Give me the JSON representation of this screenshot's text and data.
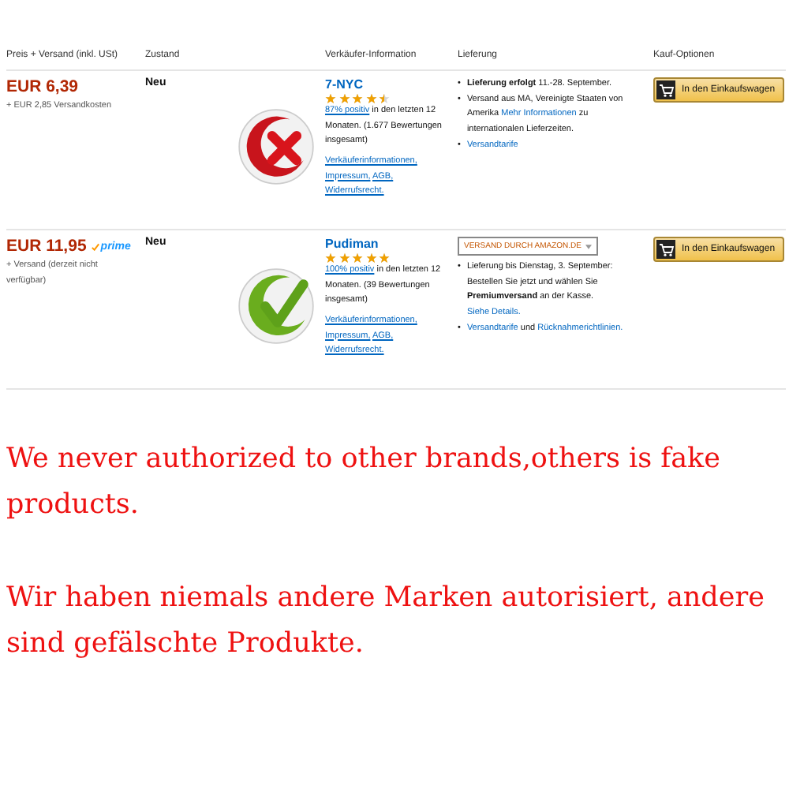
{
  "columns": [
    "Preis + Versand (inkl. USt)",
    "Zustand",
    "",
    "Verkäufer-Information",
    "Lieferung",
    "Kauf-Optionen"
  ],
  "offers": [
    {
      "price": "EUR 6,39",
      "shipping": "+ EUR 2,85 Versandkosten",
      "condition": "Neu",
      "kind": "rejected",
      "seller": "7-NYC",
      "stars": 4.5,
      "rating_link": "87% positiv",
      "rating_text": " in den letzten 12 Monaten. (1.677 Bewertungen insgesamt)",
      "seller_links": [
        "Verkäuferinformationen,",
        "Impressum,",
        "AGB,",
        "Widerrufsrecht."
      ],
      "delivery": [
        {
          "bullet": "•",
          "parts": [
            {
              "kind": "bold",
              "text": "Lieferung erfolgt"
            },
            {
              "kind": "text",
              "text": " 11.-28. September."
            }
          ]
        },
        {
          "bullet": "•",
          "parts": [
            {
              "kind": "text",
              "text": "Versand aus MA, Vereinigte Staaten von Amerika "
            },
            {
              "kind": "link",
              "text": "Mehr Informationen"
            },
            {
              "kind": "text",
              "text": " zu internationalen Lieferzeiten."
            }
          ]
        },
        {
          "bullet": "•",
          "parts": [
            {
              "kind": "link",
              "text": "Versandtarife"
            }
          ]
        }
      ],
      "button": "In den Einkaufswagen"
    },
    {
      "price": "EUR 11,95",
      "prime": "prime",
      "shipping": "+ Versand (derzeit nicht verfügbar)",
      "condition": "Neu",
      "kind": "approved",
      "seller": "Pudiman",
      "stars": 5,
      "rating_link": "100% positiv",
      "rating_text": " in den letzten 12 Monaten. (39 Bewertungen insgesamt)",
      "seller_links": [
        "Verkäuferinformationen,",
        "Impressum,",
        "AGB,",
        "Widerrufsrecht."
      ],
      "fulfillment": "VERSAND DURCH AMAZON.DE",
      "delivery": [
        {
          "bullet": "•",
          "parts": [
            {
              "kind": "text",
              "text": "Lieferung bis Dienstag, 3. September: Bestellen Sie jetzt und wählen Sie "
            },
            {
              "kind": "bold",
              "text": "Premiumversand"
            },
            {
              "kind": "text",
              "text": " an der Kasse. "
            },
            {
              "kind": "link",
              "text": "Siehe Details."
            }
          ]
        },
        {
          "bullet": "•",
          "parts": [
            {
              "kind": "link",
              "text": "Versandtarife"
            },
            {
              "kind": "text",
              "text": " und "
            },
            {
              "kind": "link",
              "text": "Rücknahmerichtlinien."
            }
          ]
        }
      ],
      "button": "In den Einkaufswagen"
    }
  ],
  "notices": [
    "We never authorized to other brands,others is fake products.",
    "Wir haben niemals andere Marken autorisiert, andere sind gefälschte Produkte."
  ]
}
